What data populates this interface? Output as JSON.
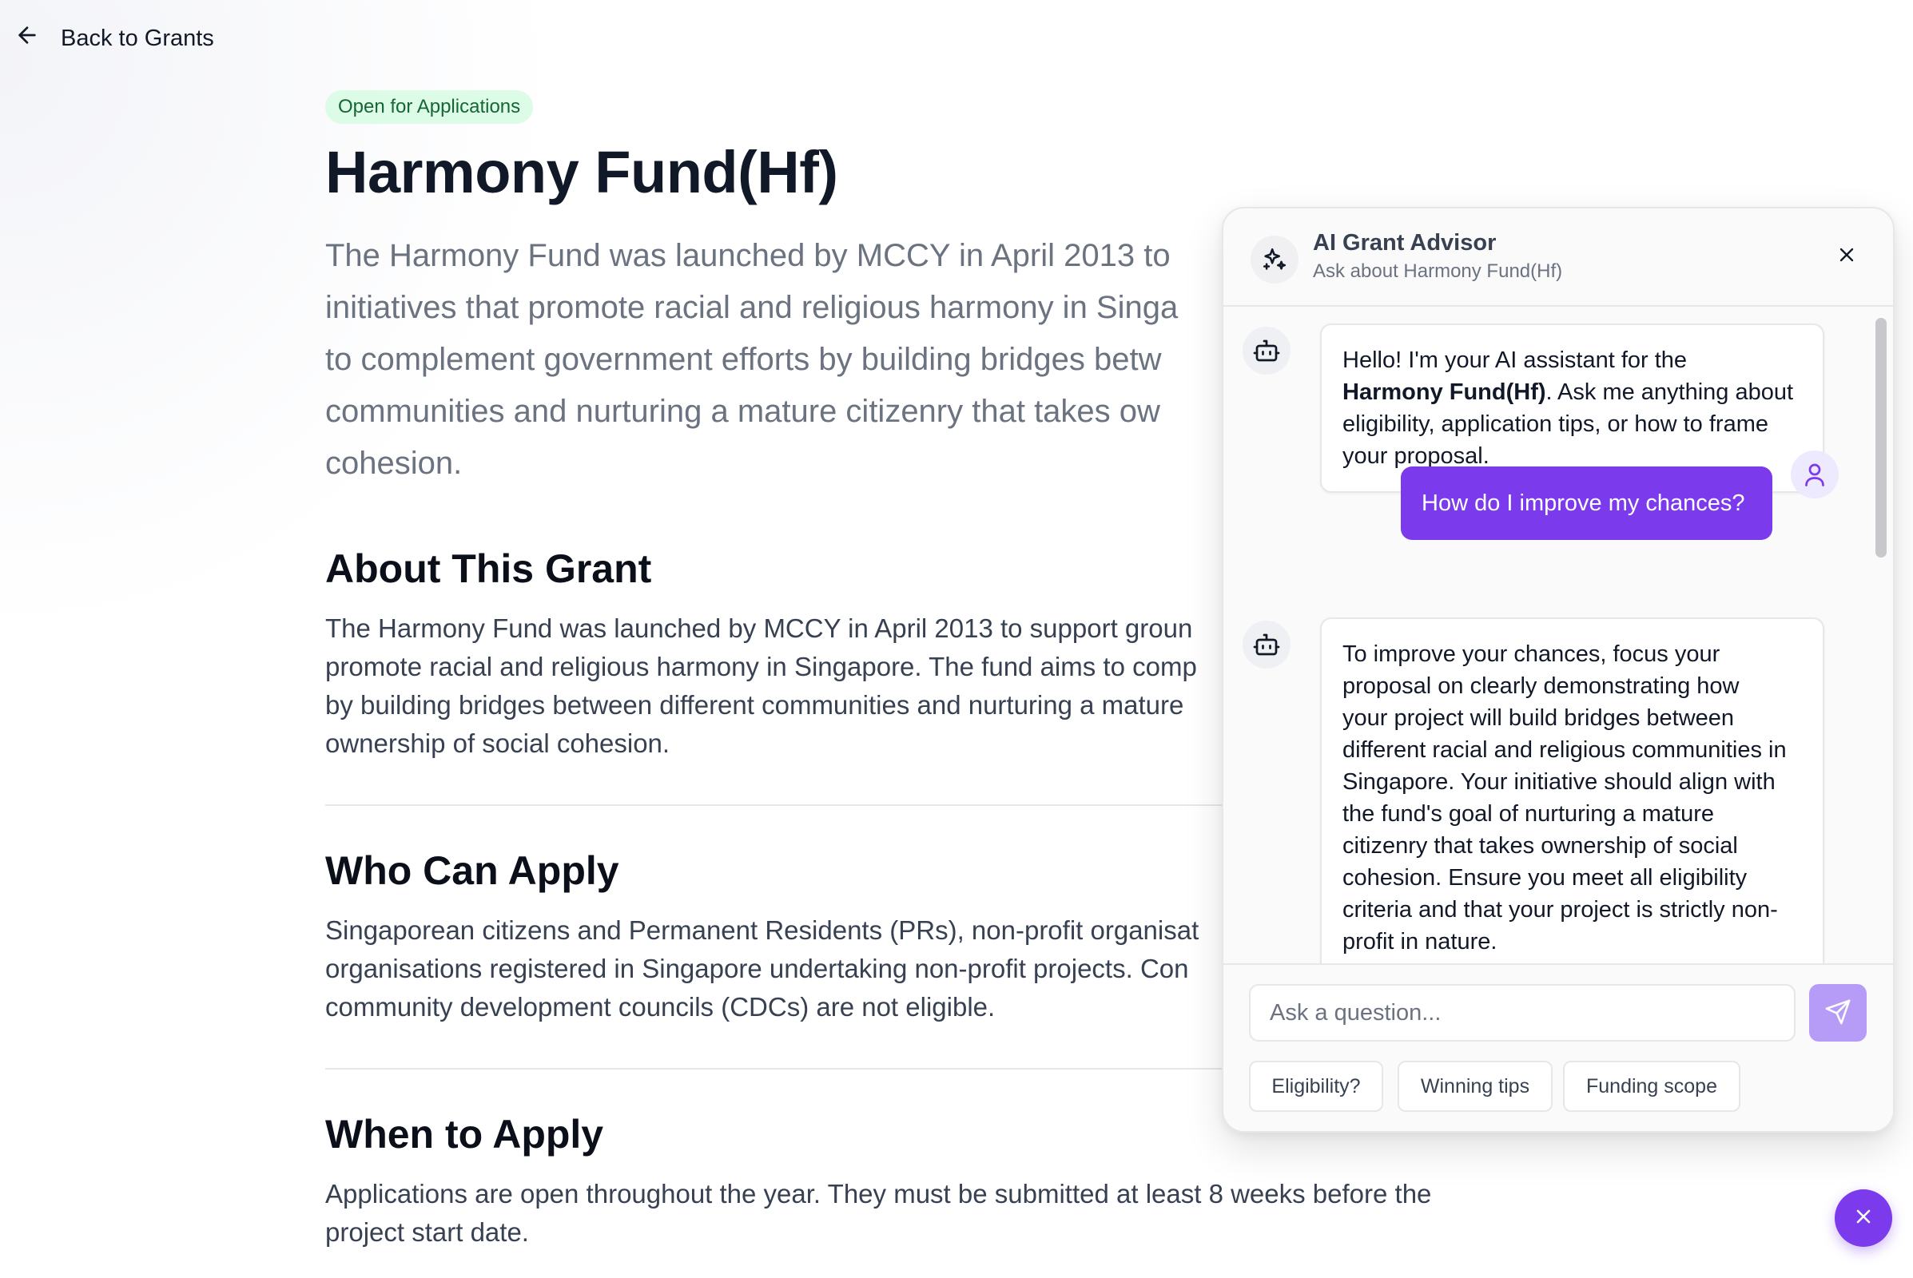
{
  "nav": {
    "back_label": "Back to Grants"
  },
  "grant": {
    "status": "Open for Applications",
    "title": "Harmony Fund(Hf)",
    "lead_lines": [
      "The Harmony Fund was launched by MCCY in April 2013 to",
      "initiatives that promote racial and religious harmony in Singa",
      "to complement government efforts by building bridges betw",
      "communities and nurturing a mature citizenry that takes ow",
      "cohesion."
    ]
  },
  "sections": {
    "about": {
      "title": "About This Grant",
      "lines": [
        "The Harmony Fund was launched by MCCY in April 2013 to support groun",
        "promote racial and religious harmony in Singapore. The fund aims to comp",
        "by building bridges between different communities and nurturing a mature",
        "ownership of social cohesion."
      ]
    },
    "who": {
      "title": "Who Can Apply",
      "lines": [
        "Singaporean citizens and Permanent Residents (PRs), non-profit organisat",
        "organisations registered in Singapore undertaking non-profit projects. Con",
        "community development councils (CDCs) are not eligible."
      ]
    },
    "when": {
      "title": "When to Apply",
      "lines": [
        "Applications are open throughout the year. They must be submitted at least 8 weeks before the",
        "project start date."
      ]
    }
  },
  "chat": {
    "title": "AI Grant Advisor",
    "subtitle": "Ask about Harmony Fund(Hf)",
    "messages": [
      {
        "role": "bot",
        "lines": [
          "Hello! I'm your AI assistant for the",
          ". Ask me anything about",
          "eligibility, application tips, or how to frame",
          "your proposal."
        ],
        "bold": "Harmony Fund(Hf)"
      },
      {
        "role": "user",
        "text": "How do I improve my chances?"
      },
      {
        "role": "bot",
        "lines": [
          "To improve your chances, focus your",
          "proposal on clearly demonstrating how",
          "your project will build bridges between",
          "different racial and religious communities in",
          "Singapore. Your initiative should align with",
          "the fund's goal of nurturing a mature",
          "citizenry that takes ownership of social",
          "cohesion. Ensure you meet all eligibility",
          "criteria and that your project is strictly non-",
          "profit in nature."
        ]
      }
    ],
    "input_placeholder": "Ask a question...",
    "input_value": "",
    "suggestions": [
      "Eligibility?",
      "Winning tips",
      "Funding scope"
    ]
  },
  "icons": {
    "back": "arrow-left-icon",
    "advisor": "sparkles-icon",
    "close": "close-icon",
    "bot": "bot-icon",
    "user": "user-icon",
    "send": "send-icon",
    "fab": "close-icon"
  },
  "colors": {
    "accent": "#7c3aed",
    "accent_light": "#b69cf6",
    "badge_bg": "#dcfce7",
    "badge_text": "#166534"
  }
}
